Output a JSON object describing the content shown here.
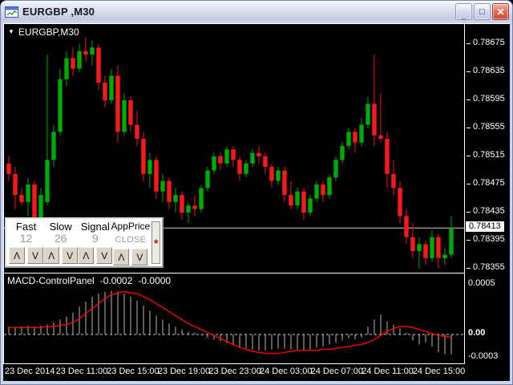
{
  "window": {
    "title": "EURGBP ,M30",
    "icon": "chart-window-icon",
    "controls": {
      "minimize_glyph": "_",
      "maximize_glyph": "□",
      "close_glyph": "✕"
    }
  },
  "chart_header": {
    "collapse_arrow": "▼",
    "symbol_label": "EURGBP,M30"
  },
  "control_panel": {
    "columns": [
      {
        "label": "Fast",
        "value": "12"
      },
      {
        "label": "Slow",
        "value": "26"
      },
      {
        "label": "Signal",
        "value": "9"
      },
      {
        "label": "AppPrice",
        "value": "CLOSE"
      }
    ],
    "up_glyph": "Λ",
    "down_glyph": "V",
    "collapse_marker": "*"
  },
  "macd_header": {
    "name": "MACD-ControlPanel",
    "main_value": "-0.0002",
    "signal_value": "-0.0000"
  },
  "chart_data": {
    "type": "candlestick",
    "symbol": "EURGBP",
    "timeframe": "M30",
    "current_price": 0.78413,
    "current_price_label": "0.78413",
    "price_axis": [
      "0.78675",
      "0.78635",
      "0.78595",
      "0.78555",
      "0.78515",
      "0.78475",
      "0.78435",
      "0.78395",
      "0.78355"
    ],
    "time_axis": [
      "23 Dec 2014",
      "23 Dec 11:00",
      "23 Dec 15:00",
      "23 Dec 19:00",
      "23 Dec 23:00",
      "24 Dec 03:00",
      "24 Dec 07:00",
      "24 Dec 11:00",
      "24 Dec 15:00"
    ],
    "macd_axis": [
      "0.0005",
      "0.00",
      "-0.0003"
    ],
    "colors": {
      "up": "#00a800",
      "down": "#f51818",
      "background": "#000000",
      "price_line": "#c8c8c8",
      "histogram": "#b8b8b8",
      "signal": "#ff0000"
    },
    "candles": [
      [
        0.78505,
        0.78515,
        0.7848,
        0.7849
      ],
      [
        0.7849,
        0.785,
        0.7844,
        0.7846
      ],
      [
        0.7846,
        0.7847,
        0.78445,
        0.7845
      ],
      [
        0.7845,
        0.78485,
        0.7843,
        0.78475
      ],
      [
        0.78475,
        0.7848,
        0.78415,
        0.78425
      ],
      [
        0.78425,
        0.7847,
        0.7842,
        0.7846
      ],
      [
        0.7845,
        0.7866,
        0.78445,
        0.7851
      ],
      [
        0.7851,
        0.7856,
        0.785,
        0.7855
      ],
      [
        0.7855,
        0.7864,
        0.78545,
        0.78625
      ],
      [
        0.78625,
        0.78665,
        0.78615,
        0.78655
      ],
      [
        0.78655,
        0.7867,
        0.7863,
        0.7864
      ],
      [
        0.7864,
        0.78675,
        0.78635,
        0.78665
      ],
      [
        0.78665,
        0.78685,
        0.7865,
        0.7866
      ],
      [
        0.7866,
        0.7868,
        0.78645,
        0.7867
      ],
      [
        0.7867,
        0.78675,
        0.7861,
        0.7862
      ],
      [
        0.7862,
        0.7863,
        0.78585,
        0.78595
      ],
      [
        0.78595,
        0.7864,
        0.7859,
        0.7863
      ],
      [
        0.7863,
        0.78645,
        0.78535,
        0.7855
      ],
      [
        0.7855,
        0.78605,
        0.78545,
        0.78595
      ],
      [
        0.78595,
        0.786,
        0.7855,
        0.7856
      ],
      [
        0.7856,
        0.7858,
        0.7853,
        0.7854
      ],
      [
        0.7854,
        0.7855,
        0.7848,
        0.7849
      ],
      [
        0.7849,
        0.7852,
        0.7847,
        0.7851
      ],
      [
        0.7851,
        0.78515,
        0.78455,
        0.78465
      ],
      [
        0.78465,
        0.7849,
        0.7845,
        0.7848
      ],
      [
        0.7848,
        0.78485,
        0.7844,
        0.7845
      ],
      [
        0.7845,
        0.7847,
        0.78435,
        0.7846
      ],
      [
        0.7846,
        0.78465,
        0.78425,
        0.78435
      ],
      [
        0.78435,
        0.7845,
        0.7842,
        0.78445
      ],
      [
        0.78445,
        0.7846,
        0.7843,
        0.7844
      ],
      [
        0.7844,
        0.78475,
        0.78435,
        0.7847
      ],
      [
        0.7847,
        0.785,
        0.78465,
        0.78495
      ],
      [
        0.78495,
        0.7852,
        0.7849,
        0.78515
      ],
      [
        0.78515,
        0.7852,
        0.78495,
        0.78505
      ],
      [
        0.78505,
        0.7853,
        0.785,
        0.78525
      ],
      [
        0.78525,
        0.7853,
        0.785,
        0.7851
      ],
      [
        0.7851,
        0.78515,
        0.7848,
        0.7849
      ],
      [
        0.7849,
        0.7851,
        0.78485,
        0.78505
      ],
      [
        0.78505,
        0.78525,
        0.785,
        0.7852
      ],
      [
        0.7852,
        0.7853,
        0.78505,
        0.78515
      ],
      [
        0.78515,
        0.7852,
        0.7849,
        0.785
      ],
      [
        0.785,
        0.78505,
        0.7847,
        0.7848
      ],
      [
        0.7848,
        0.785,
        0.78475,
        0.78495
      ],
      [
        0.78495,
        0.785,
        0.7845,
        0.7846
      ],
      [
        0.7846,
        0.7848,
        0.7844,
        0.78445
      ],
      [
        0.78445,
        0.7847,
        0.7844,
        0.78465
      ],
      [
        0.78465,
        0.7847,
        0.78425,
        0.78435
      ],
      [
        0.78435,
        0.7846,
        0.7843,
        0.78455
      ],
      [
        0.78455,
        0.7848,
        0.7845,
        0.78475
      ],
      [
        0.78475,
        0.7848,
        0.7845,
        0.7846
      ],
      [
        0.7846,
        0.7849,
        0.78455,
        0.78485
      ],
      [
        0.78485,
        0.78515,
        0.7848,
        0.7851
      ],
      [
        0.7851,
        0.78535,
        0.78505,
        0.7853
      ],
      [
        0.7853,
        0.78555,
        0.78525,
        0.7855
      ],
      [
        0.7855,
        0.78555,
        0.7852,
        0.78535
      ],
      [
        0.78535,
        0.7857,
        0.7853,
        0.7856
      ],
      [
        0.7856,
        0.786,
        0.78555,
        0.7859
      ],
      [
        0.7859,
        0.7866,
        0.7853,
        0.78545
      ],
      [
        0.78545,
        0.78605,
        0.78535,
        0.7854
      ],
      [
        0.7854,
        0.7855,
        0.7847,
        0.7849
      ],
      [
        0.7849,
        0.7851,
        0.7846,
        0.7847
      ],
      [
        0.7847,
        0.7848,
        0.7842,
        0.7843
      ],
      [
        0.7843,
        0.7844,
        0.7839,
        0.784
      ],
      [
        0.784,
        0.7842,
        0.7837,
        0.7838
      ],
      [
        0.7838,
        0.784,
        0.78355,
        0.7839
      ],
      [
        0.7839,
        0.78395,
        0.7836,
        0.7837
      ],
      [
        0.7837,
        0.7841,
        0.78365,
        0.784
      ],
      [
        0.784,
        0.78405,
        0.78355,
        0.7837
      ],
      [
        0.7837,
        0.78385,
        0.7836,
        0.78375
      ],
      [
        0.78375,
        0.7843,
        0.7837,
        0.78413
      ]
    ],
    "macd_histogram": [
      8e-05,
      7e-05,
      8e-05,
      9e-05,
      8e-05,
      9e-05,
      0.0001,
      0.00012,
      0.00015,
      0.00018,
      0.00022,
      0.00028,
      0.00033,
      0.00038,
      0.00041,
      0.00043,
      0.00044,
      0.00043,
      0.00041,
      0.00038,
      0.00034,
      0.00029,
      0.00024,
      0.00019,
      0.00015,
      0.00011,
      8e-05,
      5e-05,
      3e-05,
      2e-05,
      -1e-05,
      -3e-05,
      -5e-05,
      -7e-05,
      -9e-05,
      -0.00011,
      -0.00013,
      -0.00014,
      -0.00015,
      -0.00016,
      -0.00016,
      -0.00015,
      -0.00014,
      -0.00014,
      -0.00015,
      -0.00015,
      -0.00016,
      -0.00015,
      -0.00013,
      -0.00012,
      -0.0001,
      -8e-05,
      -6e-05,
      -4e-05,
      -5e-05,
      -3e-05,
      8e-05,
      0.00015,
      0.0002,
      0.00013,
      0.0001,
      6e-05,
      2e-05,
      -6e-05,
      -0.0001,
      -8e-05,
      -0.00012,
      -0.00018,
      -0.0002,
      -0.0002
    ],
    "macd_signal": [
      7e-05,
      7e-05,
      7e-05,
      7e-05,
      7e-05,
      7e-05,
      8e-05,
      8e-05,
      9e-05,
      0.0001,
      0.00012,
      0.00016,
      0.00021,
      0.00026,
      0.00031,
      0.00036,
      0.0004,
      0.00042,
      0.00043,
      0.00042,
      0.00041,
      0.00038,
      0.00035,
      0.00031,
      0.00027,
      0.00023,
      0.00019,
      0.00015,
      0.00011,
      8e-05,
      5e-05,
      2e-05,
      -1e-05,
      -4e-05,
      -7e-05,
      -0.0001,
      -0.00013,
      -0.00015,
      -0.00017,
      -0.00018,
      -0.00019,
      -0.00019,
      -0.00019,
      -0.00018,
      -0.00017,
      -0.00016,
      -0.00016,
      -0.00016,
      -0.00016,
      -0.00015,
      -0.00015,
      -0.00014,
      -0.00013,
      -0.00012,
      -0.00011,
      -0.0001,
      -8e-05,
      -5e-05,
      -1e-05,
      3e-05,
      6e-05,
      8e-05,
      8e-05,
      7e-05,
      5e-05,
      3e-05,
      1e-05,
      -1e-05,
      -2e-05,
      -3e-05
    ]
  }
}
